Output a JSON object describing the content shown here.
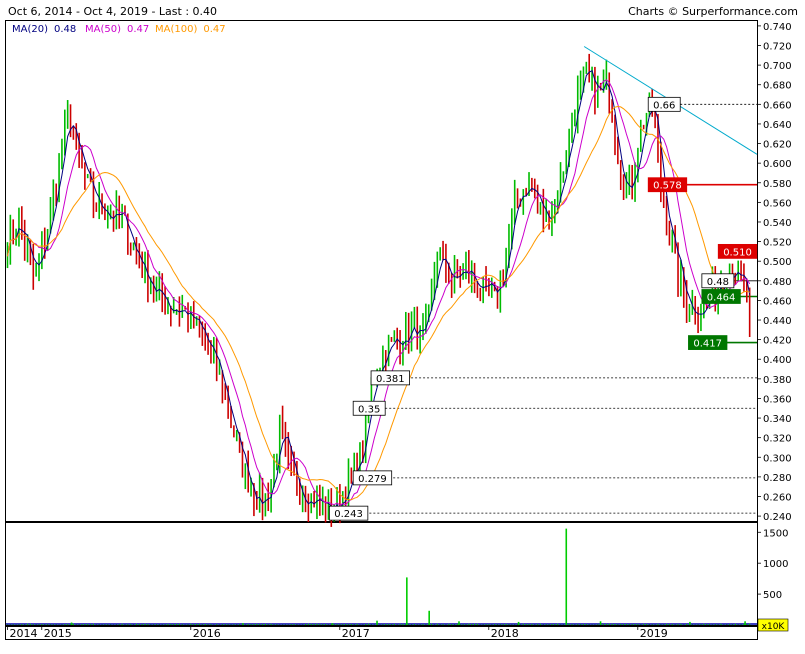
{
  "header": {
    "range_text": "Oct 6, 2014 - Oct 4, 2019 - Last : 0.40",
    "credit": "Charts © Surperformance.com"
  },
  "legend": [
    {
      "label": "MA(20)",
      "value": "0.48",
      "color": "#000080"
    },
    {
      "label": "MA(50)",
      "value": "0.47",
      "color": "#cc00cc"
    },
    {
      "label": "MA(100)",
      "value": "0.47",
      "color": "#ff9900"
    }
  ],
  "colors": {
    "up_bar": "#00bb00",
    "down_bar": "#cc0000",
    "ma20": "#000080",
    "ma50": "#cc00cc",
    "ma100": "#ff9900",
    "trendline": "#00aacc",
    "resistance": "#dd0000",
    "support": "#007700",
    "volume": "#00cc00",
    "volume_base": "#0000aa"
  },
  "chart_data": {
    "type": "line",
    "title": "",
    "series_note": "",
    "price_axis": {
      "ylim": [
        0.235,
        0.745
      ],
      "ticks": [
        0.24,
        0.26,
        0.28,
        0.3,
        0.32,
        0.34,
        0.36,
        0.38,
        0.4,
        0.42,
        0.44,
        0.46,
        0.48,
        0.5,
        0.52,
        0.54,
        0.56,
        0.58,
        0.6,
        0.62,
        0.64,
        0.66,
        0.68,
        0.7,
        0.72,
        0.74
      ],
      "tick_labels": [
        "0.240",
        "0.260",
        "0.280",
        "0.300",
        "0.320",
        "0.340",
        "0.360",
        "0.380",
        "0.400",
        "0.420",
        "0.440",
        "0.460",
        "0.480",
        "0.500",
        "0.520",
        "0.540",
        "0.560",
        "0.580",
        "0.600",
        "0.620",
        "0.640",
        "0.660",
        "0.680",
        "0.700",
        "0.720",
        "0.740"
      ]
    },
    "x_axis": {
      "xlim": [
        2014.76,
        2019.8
      ],
      "labels": [
        {
          "text": "2014",
          "x": 2014.77
        },
        {
          "text": "2015",
          "x": 2015.0
        },
        {
          "text": "2016",
          "x": 2016.0
        },
        {
          "text": "2017",
          "x": 2017.0
        },
        {
          "text": "2018",
          "x": 2018.0
        },
        {
          "text": "2019",
          "x": 2019.0
        }
      ]
    },
    "price_keypoints": [
      [
        2014.77,
        0.52
      ],
      [
        2014.85,
        0.54
      ],
      [
        2014.95,
        0.48
      ],
      [
        2015.05,
        0.54
      ],
      [
        2015.12,
        0.6
      ],
      [
        2015.18,
        0.65
      ],
      [
        2015.25,
        0.6
      ],
      [
        2015.35,
        0.56
      ],
      [
        2015.45,
        0.55
      ],
      [
        2015.55,
        0.54
      ],
      [
        2015.65,
        0.5
      ],
      [
        2015.75,
        0.47
      ],
      [
        2015.85,
        0.455
      ],
      [
        2015.95,
        0.45
      ],
      [
        2016.05,
        0.43
      ],
      [
        2016.15,
        0.4
      ],
      [
        2016.22,
        0.37
      ],
      [
        2016.28,
        0.33
      ],
      [
        2016.35,
        0.29
      ],
      [
        2016.42,
        0.265
      ],
      [
        2016.48,
        0.25
      ],
      [
        2016.55,
        0.28
      ],
      [
        2016.6,
        0.33
      ],
      [
        2016.65,
        0.29
      ],
      [
        2016.72,
        0.27
      ],
      [
        2016.8,
        0.26
      ],
      [
        2016.9,
        0.25
      ],
      [
        2016.97,
        0.247
      ],
      [
        2017.05,
        0.27
      ],
      [
        2017.12,
        0.29
      ],
      [
        2017.18,
        0.33
      ],
      [
        2017.22,
        0.38
      ],
      [
        2017.3,
        0.41
      ],
      [
        2017.4,
        0.42
      ],
      [
        2017.48,
        0.43
      ],
      [
        2017.55,
        0.42
      ],
      [
        2017.6,
        0.44
      ],
      [
        2017.65,
        0.51
      ],
      [
        2017.75,
        0.48
      ],
      [
        2017.85,
        0.49
      ],
      [
        2017.95,
        0.47
      ],
      [
        2018.05,
        0.46
      ],
      [
        2018.12,
        0.51
      ],
      [
        2018.18,
        0.56
      ],
      [
        2018.25,
        0.58
      ],
      [
        2018.3,
        0.57
      ],
      [
        2018.38,
        0.54
      ],
      [
        2018.45,
        0.56
      ],
      [
        2018.52,
        0.61
      ],
      [
        2018.58,
        0.66
      ],
      [
        2018.65,
        0.69
      ],
      [
        2018.72,
        0.67
      ],
      [
        2018.8,
        0.68
      ],
      [
        2018.85,
        0.63
      ],
      [
        2018.9,
        0.58
      ],
      [
        2018.95,
        0.57
      ],
      [
        2019.0,
        0.62
      ],
      [
        2019.05,
        0.65
      ],
      [
        2019.1,
        0.66
      ],
      [
        2019.15,
        0.58
      ],
      [
        2019.2,
        0.54
      ],
      [
        2019.25,
        0.5
      ],
      [
        2019.32,
        0.46
      ],
      [
        2019.4,
        0.45
      ],
      [
        2019.48,
        0.46
      ],
      [
        2019.55,
        0.48
      ],
      [
        2019.62,
        0.5
      ],
      [
        2019.68,
        0.48
      ],
      [
        2019.73,
        0.47
      ],
      [
        2019.76,
        0.4
      ]
    ],
    "moving_averages": [
      {
        "name": "MA(20)",
        "period_weeks": 4
      },
      {
        "name": "MA(50)",
        "period_weeks": 10
      },
      {
        "name": "MA(100)",
        "period_weeks": 20
      }
    ],
    "annotations": [
      {
        "text": "0.66",
        "value": 0.66,
        "x": 2019.07,
        "kind": "box",
        "line_to": 2019.8,
        "dashed": true
      },
      {
        "text": "0.578",
        "value": 0.578,
        "x": 2019.07,
        "kind": "red",
        "line_to": 2019.8
      },
      {
        "text": "0.510",
        "value": 0.51,
        "x": 2019.54,
        "kind": "red",
        "line_to": 2019.8
      },
      {
        "text": "0.48",
        "value": 0.48,
        "x": 2019.43,
        "kind": "box",
        "line_to": 2019.8
      },
      {
        "text": "0.464",
        "value": 0.464,
        "x": 2019.43,
        "kind": "green",
        "line_to": 2019.8
      },
      {
        "text": "0.417",
        "value": 0.417,
        "x": 2019.34,
        "kind": "green",
        "line_to": 2019.8
      },
      {
        "text": "0.381",
        "value": 0.381,
        "x": 2017.21,
        "kind": "box",
        "line_to": 2019.8,
        "dashed": true
      },
      {
        "text": "0.35",
        "value": 0.35,
        "x": 2017.09,
        "kind": "box",
        "line_to": 2019.8,
        "dashed": true
      },
      {
        "text": "0.279",
        "value": 0.279,
        "x": 2017.09,
        "kind": "box",
        "line_to": 2019.8,
        "dashed": true
      },
      {
        "text": "0.243",
        "value": 0.243,
        "x": 2016.93,
        "kind": "box",
        "line_to": 2019.8,
        "dashed": true
      }
    ],
    "trendline": {
      "from": [
        2018.64,
        0.719
      ],
      "to": [
        2019.8,
        0.609
      ]
    },
    "volume_axis": {
      "ylim": [
        0,
        1650
      ],
      "ticks": [
        500,
        1000,
        1500
      ],
      "tick_labels": [
        "500",
        "1000",
        "1500"
      ],
      "unit_label": "x10K"
    },
    "volume_spikes": [
      {
        "x": 2015.2,
        "value": 40
      },
      {
        "x": 2016.35,
        "value": 30
      },
      {
        "x": 2016.95,
        "value": 30
      },
      {
        "x": 2017.25,
        "value": 70
      },
      {
        "x": 2017.45,
        "value": 770
      },
      {
        "x": 2017.6,
        "value": 230
      },
      {
        "x": 2017.8,
        "value": 60
      },
      {
        "x": 2018.2,
        "value": 50
      },
      {
        "x": 2018.52,
        "value": 1560
      },
      {
        "x": 2018.75,
        "value": 60
      },
      {
        "x": 2019.35,
        "value": 50
      },
      {
        "x": 2019.72,
        "value": 60
      }
    ]
  }
}
